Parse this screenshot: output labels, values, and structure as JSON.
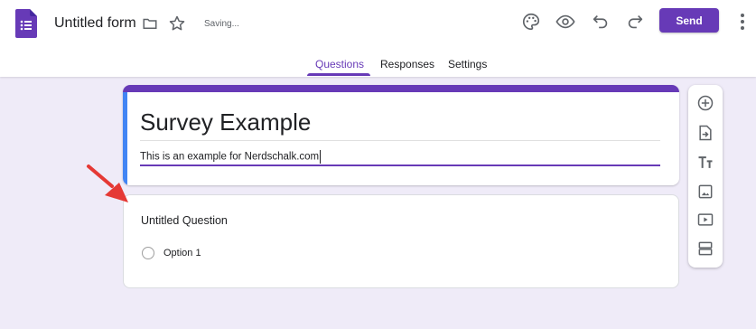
{
  "header": {
    "title": "Untitled form",
    "status": "Saving...",
    "send_label": "Send",
    "icons": [
      "forms-logo-icon",
      "folder-icon",
      "star-icon",
      "palette-icon",
      "preview-eye-icon",
      "undo-icon",
      "redo-icon",
      "more-vert-icon"
    ]
  },
  "tabs": [
    {
      "label": "Questions",
      "active": true
    },
    {
      "label": "Responses",
      "active": false
    },
    {
      "label": "Settings",
      "active": false
    }
  ],
  "form": {
    "title": "Survey Example",
    "description": "This is an example for Nerdschalk.com"
  },
  "question": {
    "title": "Untitled Question",
    "options": [
      "Option 1"
    ]
  },
  "toolbar": {
    "items": [
      "add-question-icon",
      "import-questions-icon",
      "add-title-description-icon",
      "add-image-icon",
      "add-video-icon",
      "add-section-icon"
    ]
  },
  "colors": {
    "accent": "#673ab7",
    "background": "#efebf8",
    "title_card_left_bar": "#4285f4",
    "annotation_arrow": "#e53935"
  }
}
